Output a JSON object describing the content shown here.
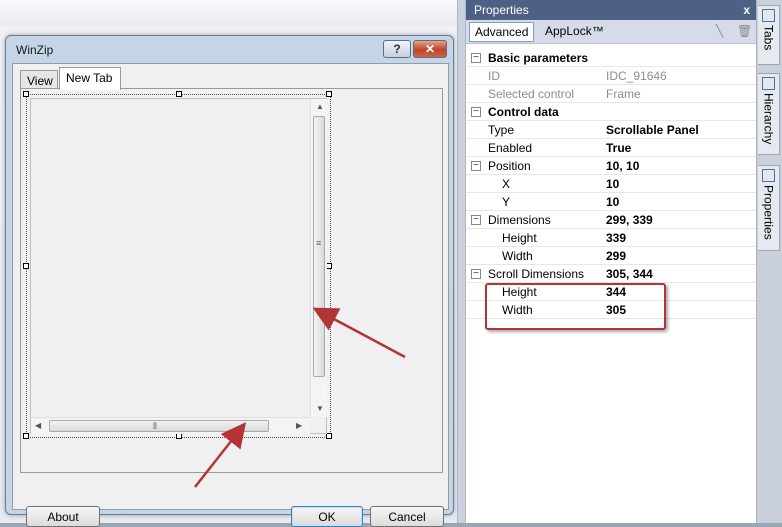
{
  "dialog": {
    "title": "WinZip",
    "help_label": "?",
    "close_label": "✕",
    "tabs": [
      {
        "label": "View"
      },
      {
        "label": "New Tab"
      }
    ],
    "buttons": {
      "about": "About",
      "ok": "OK",
      "cancel": "Cancel"
    }
  },
  "properties": {
    "title": "Properties",
    "close_label": "x",
    "tabs": [
      {
        "label": "Advanced"
      },
      {
        "label": "AppLock™"
      }
    ],
    "rows": [
      {
        "kind": "category",
        "toggle": "⊟",
        "name": "Basic parameters"
      },
      {
        "kind": "prop",
        "name": "ID",
        "value": "IDC_91646",
        "disabled": true
      },
      {
        "kind": "prop",
        "name": "Selected control",
        "value": "Frame",
        "disabled": true
      },
      {
        "kind": "category",
        "toggle": "⊟",
        "name": "Control data"
      },
      {
        "kind": "prop",
        "name": "Type",
        "value": "Scrollable Panel",
        "bold": true
      },
      {
        "kind": "prop",
        "name": "Enabled",
        "value": "True",
        "bold": true
      },
      {
        "kind": "group",
        "toggle": "⊟",
        "name": "Position",
        "value": "10, 10",
        "bold": true
      },
      {
        "kind": "sub",
        "name": "X",
        "value": "10",
        "bold": true
      },
      {
        "kind": "sub",
        "name": "Y",
        "value": "10",
        "bold": true
      },
      {
        "kind": "group",
        "toggle": "⊟",
        "name": "Dimensions",
        "value": "299, 339",
        "bold": true
      },
      {
        "kind": "sub",
        "name": "Height",
        "value": "339",
        "bold": true
      },
      {
        "kind": "sub",
        "name": "Width",
        "value": "299",
        "bold": true
      },
      {
        "kind": "group",
        "toggle": "⊟",
        "name": "Scroll Dimensions",
        "value": "305, 344",
        "bold": true
      },
      {
        "kind": "sub",
        "name": "Height",
        "value": "344",
        "bold": true
      },
      {
        "kind": "sub",
        "name": "Width",
        "value": "305",
        "bold": true
      }
    ]
  },
  "side_tabs": [
    {
      "label": "Tabs"
    },
    {
      "label": "Hierarchy"
    },
    {
      "label": "Properties"
    }
  ],
  "colors": {
    "annotation": "#b33434",
    "title_bar": "#4d6185"
  }
}
